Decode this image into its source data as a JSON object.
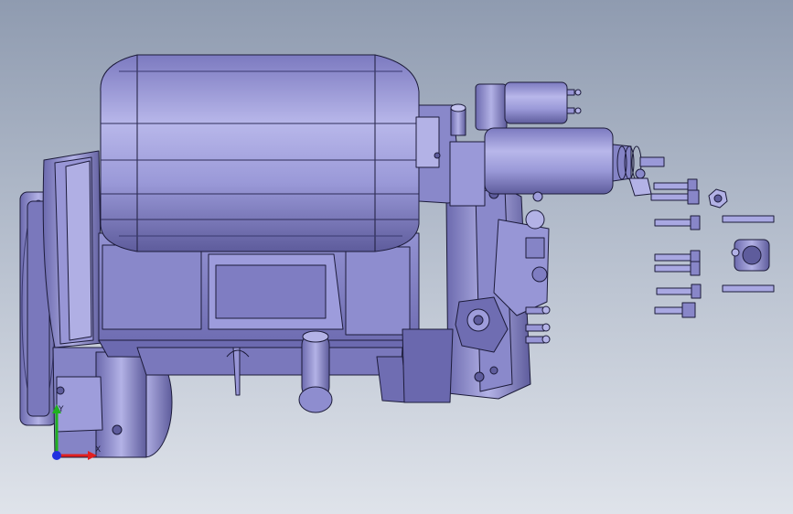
{
  "viewport": {
    "background_top": "#8f9bb0",
    "background_bottom": "#dfe3ea"
  },
  "model": {
    "body_color": "#8886c8",
    "body_dark": "#5e5c9c",
    "body_light": "#b3b2e6",
    "edge_color": "#1c1b3a"
  },
  "triad": {
    "x_label": "X",
    "y_label": "Y",
    "x_color": "#e02020",
    "y_color": "#20b020",
    "z_color": "#2030e0"
  }
}
